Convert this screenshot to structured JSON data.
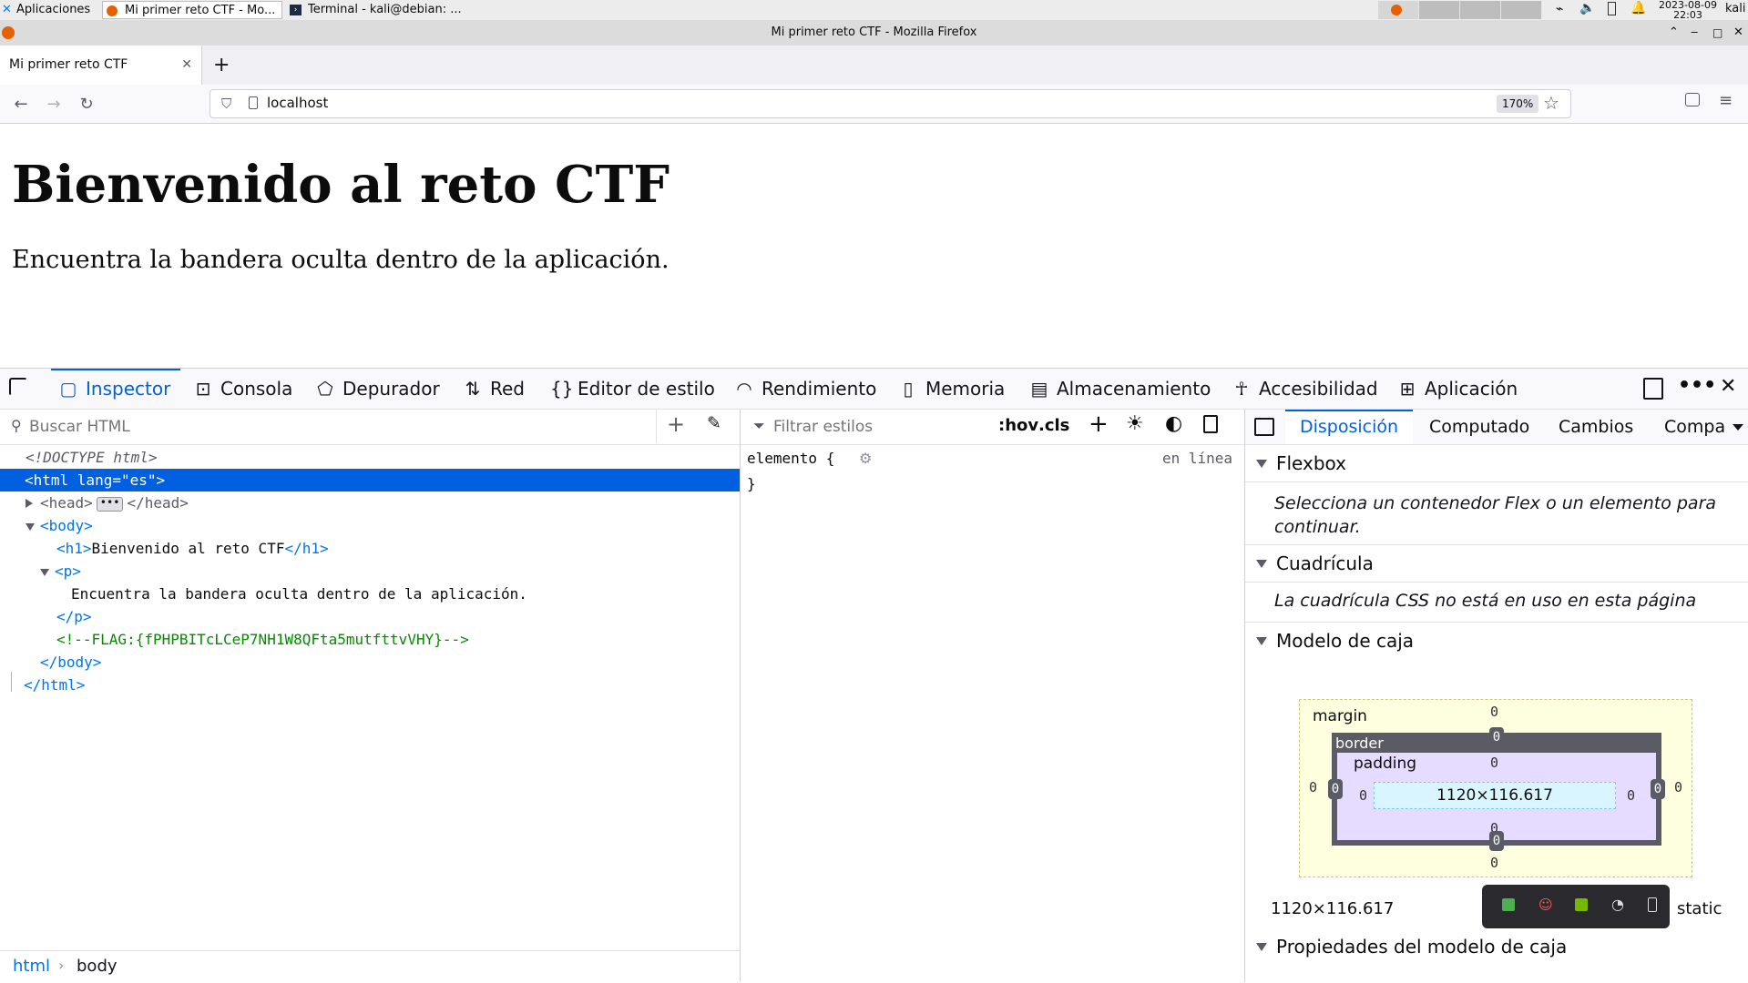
{
  "taskbar": {
    "apps_menu": "Aplicaciones",
    "tasks": [
      "Mi primer reto CTF - Mo...",
      "Terminal - kali@debian: ..."
    ],
    "date": "2023-08-09",
    "time": "22:03",
    "user": "kali"
  },
  "window": {
    "title": "Mi primer reto CTF - Mozilla Firefox"
  },
  "browser": {
    "tab_title": "Mi primer reto CTF",
    "url": "localhost",
    "zoom": "170%"
  },
  "page": {
    "heading": "Bienvenido al reto CTF",
    "paragraph": "Encuentra la bandera oculta dentro de la aplicación."
  },
  "devtools": {
    "tabs": [
      "Inspector",
      "Consola",
      "Depurador",
      "Red",
      "Editor de estilo",
      "Rendimiento",
      "Memoria",
      "Almacenamiento",
      "Accesibilidad",
      "Aplicación"
    ],
    "selected_tab": "Inspector",
    "markup": {
      "search_placeholder": "Buscar HTML",
      "doctype": "<!DOCTYPE html>",
      "html_open": "<html lang=\"es\">",
      "head_open": "<head>",
      "head_close": "</head>",
      "body_open": "<body>",
      "h1_line_open": "<h1>",
      "h1_text": "Bienvenido al reto CTF",
      "h1_line_close": "</h1>",
      "p_open": "<p>",
      "p_text": "Encuentra la bandera oculta dentro de la aplicación.",
      "p_close": "</p>",
      "comment": "<!--FLAG:{fPHPBITcLCeP7NH1W8QFta5mutfttvVHY}-->",
      "body_close": "</body>",
      "html_close": "</html>",
      "breadcrumbs": [
        "html",
        "body"
      ]
    },
    "rules": {
      "filter_placeholder": "Filtrar estilos",
      "pseudo_btn": ":hov",
      "cls_btn": ".cls",
      "selector": "elemento {",
      "close_brace": "}",
      "source": "en línea"
    },
    "layout": {
      "tabs": [
        "Disposición",
        "Computado",
        "Cambios",
        "Compa"
      ],
      "selected_tab": "Disposición",
      "flexbox_title": "Flexbox",
      "flexbox_msg": "Selecciona un contenedor Flex o un elemento para continuar.",
      "grid_title": "Cuadrícula",
      "grid_msg": "La cuadrícula CSS no está en uso en esta página",
      "boxmodel_title": "Modelo de caja",
      "box": {
        "margin_label": "margin",
        "border_label": "border",
        "padding_label": "padding",
        "content_size": "1120×116.617",
        "zero": "0"
      },
      "size_footer": "1120×116.617",
      "position": "static",
      "props_title": "Propiedades del modelo de caja"
    }
  },
  "colors": {
    "accent": "#0061e0",
    "selection_bg": "#0060df",
    "comment_green": "#058b00",
    "margin_bg": "#fdffdf",
    "border_bg": "#5b5b66",
    "padding_bg": "#e5dcff",
    "content_bg": "#d9f5ff"
  }
}
